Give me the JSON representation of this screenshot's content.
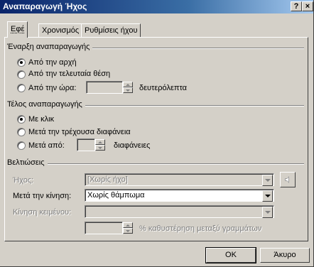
{
  "window": {
    "title": "Αναπαραγωγή Ήχος",
    "help_glyph": "?",
    "close_glyph": "×"
  },
  "tabs": [
    {
      "label": "Εφέ",
      "active": true
    },
    {
      "label": "Χρονισμός",
      "active": false
    },
    {
      "label": "Ρυθμίσεις ήχου",
      "active": false
    }
  ],
  "start": {
    "heading": "Έναρξη αναπαραγωγής",
    "options": [
      "Από την αρχή",
      "Από την τελευταία θέση",
      "Από την ώρα:"
    ],
    "selected_index": 0,
    "time_value": "",
    "seconds_label": "δευτερόλεπτα"
  },
  "stop": {
    "heading": "Τέλος αναπαραγωγής",
    "options": [
      "Με κλικ",
      "Μετά την τρέχουσα διαφάνεια",
      "Μετά από:"
    ],
    "selected_index": 0,
    "slides_value": "",
    "slides_label": "διαφάνειες"
  },
  "enhancements": {
    "heading": "Βελτιώσεις",
    "sound_label": "Ήχος:",
    "sound_value": "[Χωρίς ήχο]",
    "sound_icon": "speaker-icon",
    "after_animation_label": "Μετά την κίνηση:",
    "after_animation_value": "Χωρίς θάμπωμα",
    "animate_text_label": "Κίνηση κειμένου:",
    "animate_text_value": "",
    "delay_value": "",
    "delay_label": "% καθυστέρηση μεταξύ γραμμάτων"
  },
  "buttons": {
    "ok": "OK",
    "cancel": "Άκυρο"
  }
}
